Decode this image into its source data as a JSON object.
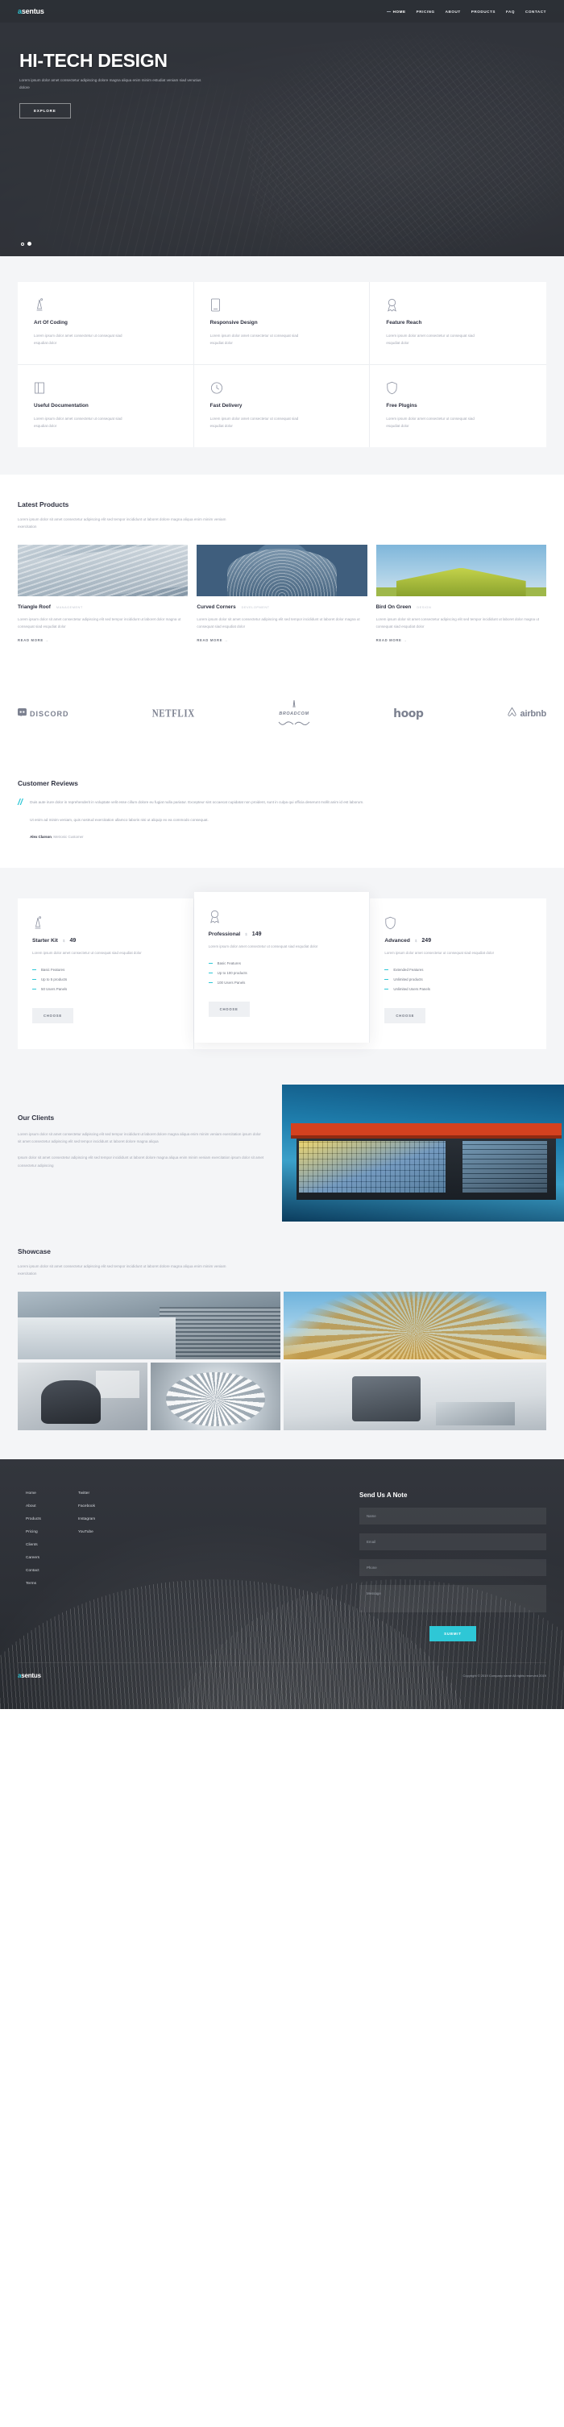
{
  "brand": {
    "name": "asentus",
    "mark": "a",
    "rest": "sentus",
    "accent": "#2ec7d6"
  },
  "nav": {
    "items": [
      {
        "label": "HOME",
        "active": true
      },
      {
        "label": "PRICING",
        "active": false
      },
      {
        "label": "ABOUT",
        "active": false
      },
      {
        "label": "PRODUCTS",
        "active": false
      },
      {
        "label": "FAQ",
        "active": false
      },
      {
        "label": "CONTACT",
        "active": false
      }
    ]
  },
  "hero": {
    "title": "HI-TECH DESIGN",
    "subtitle": "Lorem ipsum dolor amet consectetur adipiscing dolore magna aliqua enim minim estudiat veniam siad venutius dolore",
    "cta": "EXPLORE",
    "slide_current": 2,
    "slide_total": 2
  },
  "features": [
    {
      "icon": "lamp-icon",
      "title": "Art Of Coding",
      "text": "Lorem ipsum dolor amet consectetur ut consequat siad esqudiat dolor"
    },
    {
      "icon": "tablet-icon",
      "title": "Responsive Design",
      "text": "Lorem ipsum dolor amet consectetur ut consequat siad esqudiat dolor"
    },
    {
      "icon": "medal-icon",
      "title": "Feature Reach",
      "text": "Lorem ipsum dolor amet consectetur ut consequat siad esqudiat dolor"
    },
    {
      "icon": "book-icon",
      "title": "Useful Documentation",
      "text": "Lorem ipsum dolor amet consectetur ut consequat siad esqudiat dolor"
    },
    {
      "icon": "clock-icon",
      "title": "Fast Delivery",
      "text": "Lorem ipsum dolor amet consectetur ut consequat siad esqudiat dolor"
    },
    {
      "icon": "shield-icon",
      "title": "Free Plugins",
      "text": "Lorem ipsum dolor amet consectetur ut consequat siad esqudiat dolor"
    }
  ],
  "latest_products": {
    "heading": "Latest Products",
    "lead": "Lorem ipsum dolor sit amet consectetur adipiscing elit sed tempor incididunt ut laboret dolore magna aliqua enim minim veniam exercitation",
    "items": [
      {
        "title": "Triangle Roof",
        "tag": "MANAGEMENT",
        "text": "Lorem ipsum dolor sit amet consectetur adipiscing elit sed tempor incididunt ut laboret dolor magna ut consequat siad esqudiat dolor",
        "link": "READ MORE",
        "arrow": "→"
      },
      {
        "title": "Curved Corners",
        "tag": "DEVELOPMENT",
        "text": "Lorem ipsum dolor sit amet consectetur adipiscing elit sed tempor incididunt ut laboret dolor magna ut consequat siad esqudiat dolor",
        "link": "READ MORE",
        "arrow": "→"
      },
      {
        "title": "Bird On Green",
        "tag": "DESIGN",
        "text": "Lorem ipsum dolor sit amet consectetur adipiscing elit sed tempor incididunt ut laboret dolor magna ut consequat siad esqudiat dolor",
        "link": "READ MORE",
        "arrow": "→"
      }
    ]
  },
  "brands": [
    {
      "name": "DISCORD",
      "icon": "discord-icon"
    },
    {
      "name": "NETFLIX",
      "icon": "netflix-logo"
    },
    {
      "name": "BROADCOM",
      "icon": "broadcom-logo"
    },
    {
      "name": "hoop",
      "icon": "hoop-logo"
    },
    {
      "name": "airbnb",
      "icon": "airbnb-icon"
    }
  ],
  "reviews": {
    "heading": "Customer Reviews",
    "quote_mark": "//",
    "paragraph1": "Duis aute irure dolor in reprehenderit in voluptate velit esse cillum dolore eu fugiat nulla pariatur. Excepteur sint occaecat cupidatat non proident, sunt in culpa qui officia deserunt mollit anim id est laborum.",
    "paragraph2": "Ut enim ad minim veniam, quis nostrud exercitation ullamco laboris nisi ut aliquip ex ea commodo consequat.",
    "author_name": "Alex Clarson",
    "author_role": "Metronic Customer"
  },
  "pricing": [
    {
      "icon": "lamp-icon",
      "name": "Starter Kit",
      "currency": "$",
      "amount": "49",
      "desc": "Lorem ipsum dolor amet consectetur ut consequat siad esqudiat dolor",
      "features": [
        "Basic Features",
        "Up to 5 products",
        "50 Users Panels"
      ],
      "cta": "CHOOSE",
      "featured": false
    },
    {
      "icon": "medal-icon",
      "name": "Professional",
      "currency": "$",
      "amount": "149",
      "desc": "Lorem ipsum dolor amet consectetur ut consequat siad esqudiat dolor",
      "features": [
        "Basic Features",
        "Up to 100 products",
        "100 Users Panels"
      ],
      "cta": "CHOOSE",
      "featured": true
    },
    {
      "icon": "shield-icon",
      "name": "Advanced",
      "currency": "$",
      "amount": "249",
      "desc": "Lorem ipsum dolor amet consectetur ut consequat siad esqudiat dolor",
      "features": [
        "Extended Features",
        "Unlimited products",
        "Unlimited Users Panels"
      ],
      "cta": "CHOOSE",
      "featured": false
    }
  ],
  "clients": {
    "heading": "Our Clients",
    "p1": "Lorem ipsum dolor sit amet consectetur adipiscing elit sed tempor incididunt ut laboret dolore magna aliqua enim minim veniam exercitation ipsum dolor sit amet consectetur adipiscing elit sed tempor incididunt ut laboret dolore magna aliqua",
    "p2": "Ipsum dolor sit amet consectetur adipiscing elit sed tempor incididunt ut laboret dolore magna aliqua enim minim veniam exercitation ipsum dolor sit amet consectetur adipiscing"
  },
  "showcase": {
    "heading": "Showcase",
    "lead": "Lorem ipsum dolor sit amet consectetur adipiscing elit sed tempor incididunt ut laboret dolore magna aliqua enim minim veniam exercitation",
    "tiles": [
      "glass-facade-photo",
      "dome-pattern-photo",
      "architect-worker-photo",
      "honeycomb-dome-photo",
      "sneakers-stairs-photo"
    ]
  },
  "footer": {
    "links_col1": [
      "Home",
      "About",
      "Products",
      "Pricing",
      "Clients",
      "Careers",
      "Contact",
      "Terms"
    ],
    "links_col2": [
      "Twitter",
      "Facebook",
      "Instagram",
      "YouTube"
    ],
    "form": {
      "heading": "Send Us A Note",
      "name_placeholder": "Name",
      "email_placeholder": "Email",
      "phone_placeholder": "Phone",
      "message_placeholder": "Message",
      "submit": "SUBMIT"
    },
    "copyright": "Copyright © 2019 Company name All rights reserved 2019"
  }
}
